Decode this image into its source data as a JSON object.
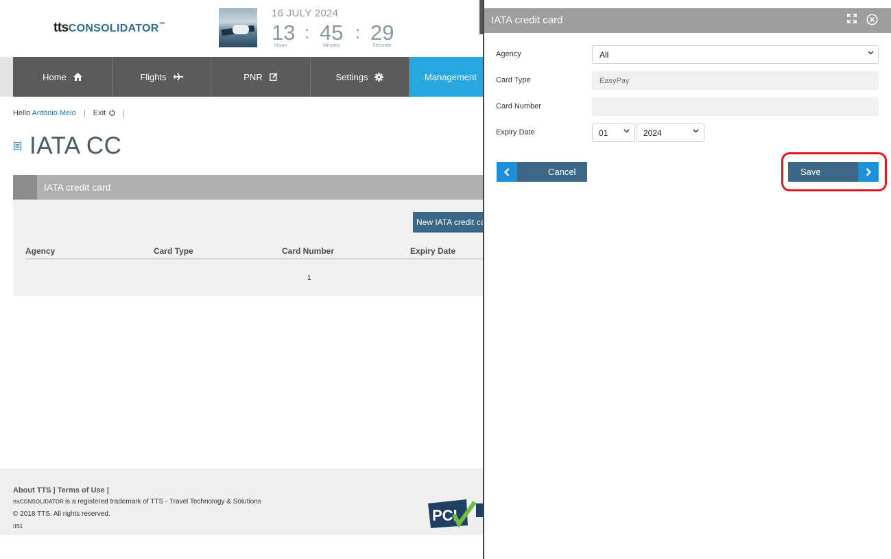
{
  "brand": {
    "tts": "tts",
    "consolidator": "CONSOLIDATOR",
    "tm": "™"
  },
  "clock": {
    "date": "16 JULY 2024",
    "hours": "13",
    "minutes": "45",
    "seconds": "29",
    "hours_label": "Hours",
    "minutes_label": "Minutes",
    "seconds_label": "Seconds",
    "separator": ":"
  },
  "nav": [
    {
      "label": "Home",
      "icon": "home-icon"
    },
    {
      "label": "Flights",
      "icon": "plane-icon"
    },
    {
      "label": "PNR",
      "icon": "edit-icon"
    },
    {
      "label": "Settings",
      "icon": "gear-icon"
    },
    {
      "label": "Management",
      "icon": ""
    }
  ],
  "user_bar": {
    "hello": "Hello",
    "user": "António Melo",
    "pipe": "|",
    "exit": "Exit",
    "pipe2": "|"
  },
  "page": {
    "title": "IATA CC",
    "panel_title": "IATA credit card",
    "new_button": "New IATA credit card",
    "columns": [
      "Agency",
      "Card Type",
      "Card Number",
      "Expiry Date"
    ],
    "pager": "1"
  },
  "footer": {
    "links": "About TTS |  Terms of Use |",
    "brand_small": "ttsCONSOLIDATOR",
    "trademark": "is a registered trademark of TTS - Travel Technology & Solutions",
    "copyright": "© 2018 TTS. All rights reserved.",
    "server": "IIS1",
    "pci_badge": "PCI"
  },
  "modal": {
    "title": "IATA credit card",
    "labels": {
      "agency": "Agency",
      "card_type": "Card Type",
      "card_number": "Card Number",
      "expiry": "Expiry Date"
    },
    "agency_value": "All",
    "card_type_value": "EasyPay",
    "card_number_value": "",
    "expiry_month": "01",
    "expiry_year": "2024",
    "cancel": "Cancel",
    "save": "Save",
    "highlight_color": "#e3141e"
  }
}
